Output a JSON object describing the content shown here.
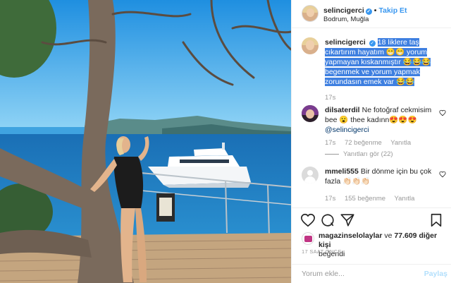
{
  "post": {
    "username": "selincigerci",
    "follow_label": "Takip Et",
    "location": "Bodrum, Muğla",
    "caption": {
      "username": "selincigerci",
      "text": "18 liklere taş cıkartırım hayatım 😁😁 yorum yapmayan kıskanmıştır 😂😂😂 begenmek ve yorum yapmak zorundasın emek var 😂😂",
      "time": "17s"
    }
  },
  "comments": [
    {
      "username": "dilsaterdil",
      "text": "Ne fotoğraf cekmisim bee 😮 thee kadınn😍😍😍",
      "mention": "@selincigerci",
      "time": "17s",
      "likes": "72 beğenme",
      "reply_label": "Yanıtla",
      "replies_label": "Yanıtları gör (22)"
    },
    {
      "username": "mmeli555",
      "text": "Bir dönme için bu çok fazla 👏🏻👏🏻👏🏻",
      "time": "17s",
      "likes": "155 beğenme",
      "reply_label": "Yanıtla"
    }
  ],
  "likes_summary": {
    "user": "magazinselolaylar",
    "connector": "ve",
    "others": "77.609 diğer kişi",
    "suffix": "beğendi"
  },
  "timestamp": "17 SAAT ÖNCE",
  "comment_box": {
    "placeholder": "Yorum ekle...",
    "post_label": "Paylaş"
  },
  "icons": {
    "like": "heart-icon",
    "comment": "comment-icon",
    "share": "share-icon",
    "save": "bookmark-icon",
    "verified": "verified-badge-icon"
  },
  "colors": {
    "accent": "#3897f0",
    "highlight": "#3e7fe0",
    "muted": "#999999",
    "text": "#262626"
  }
}
